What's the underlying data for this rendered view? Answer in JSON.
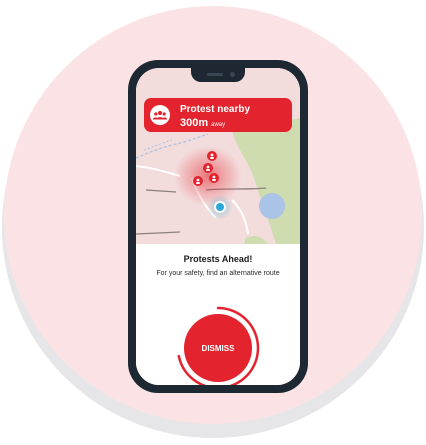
{
  "alert": {
    "title": "Protest nearby",
    "distance": "300m",
    "distance_unit": "away",
    "icon": "crowd-icon"
  },
  "map": {
    "protest_markers": [
      "protest-marker-icon",
      "protest-marker-icon",
      "protest-marker-icon",
      "protest-marker-icon"
    ],
    "user_location": "user-location-icon"
  },
  "content": {
    "heading": "Protests Ahead!",
    "message": "For your safety, find an alternative route",
    "dismiss_label": "DISMISS"
  },
  "colors": {
    "accent": "#e3232d",
    "background": "#fbe3e5",
    "phone": "#1e2833",
    "map_park": "#cfdcb0",
    "map_water": "#a9c4e6",
    "location": "#2aa7d8"
  }
}
